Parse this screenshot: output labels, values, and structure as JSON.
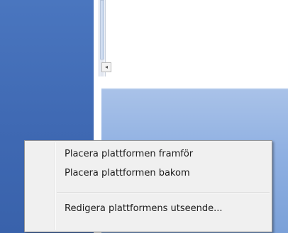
{
  "context_menu": {
    "items": [
      {
        "label": "Placera plattformen framför"
      },
      {
        "label": "Placera plattformen bakom"
      },
      {
        "label": "Redigera plattformens utseende..."
      }
    ]
  },
  "scrollbar": {
    "arrow_icon": "left-arrow-icon",
    "arrow_glyph": "◂"
  },
  "colors": {
    "desktop_blue": "#3f69b3",
    "window_blue": "#8fb0e2",
    "menu_background": "#f0f0f0"
  }
}
